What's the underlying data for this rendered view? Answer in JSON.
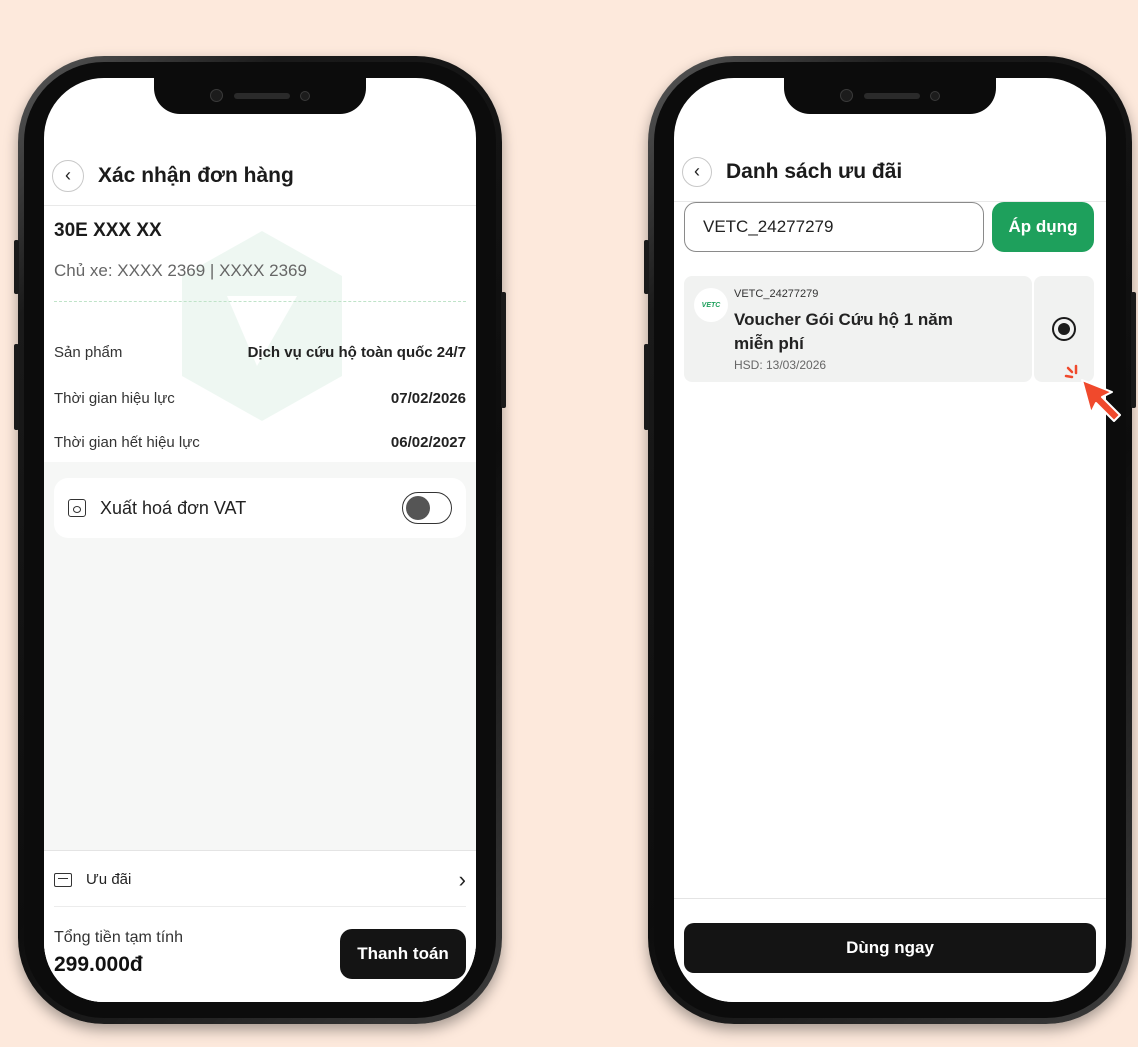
{
  "left": {
    "title": "Xác nhận đơn hàng",
    "plate": "30E XXX XX",
    "owner": "Chủ xe: XXXX 2369 | XXXX 2369",
    "rows": [
      {
        "label": "Sản phẩm",
        "value": "Dịch vụ cứu hộ toàn quốc 24/7"
      },
      {
        "label": "Thời gian hiệu lực",
        "value": "07/02/2026"
      },
      {
        "label": "Thời gian hết hiệu lực",
        "value": "06/02/2027"
      }
    ],
    "vat_label": "Xuất hoá đơn VAT",
    "vat_toggle_on": false,
    "promo_label": "Ưu đãi",
    "total_label": "Tổng tiền tạm tính",
    "total_value": "299.000đ",
    "pay_label": "Thanh toán"
  },
  "right": {
    "title": "Danh sách ưu đãi",
    "code_value": "VETC_24277279",
    "apply_label": "Áp dụng",
    "voucher": {
      "logo_text": "VETC",
      "code": "VETC_24277279",
      "name": " Voucher Gói Cứu hộ 1 năm\nmiễn phí",
      "expiry": "HSD: 13/03/2026",
      "selected": true
    },
    "use_label": "Dùng ngay"
  },
  "colors": {
    "background": "#fde9dc",
    "accent_green": "#1ea05c",
    "dark_button": "#141414",
    "cursor_red": "#f0492c"
  },
  "icons": [
    "back-chevron-icon",
    "receipt-icon",
    "ticket-icon",
    "chevron-right-icon",
    "vetc-logo-icon",
    "pointer-cursor-icon"
  ]
}
